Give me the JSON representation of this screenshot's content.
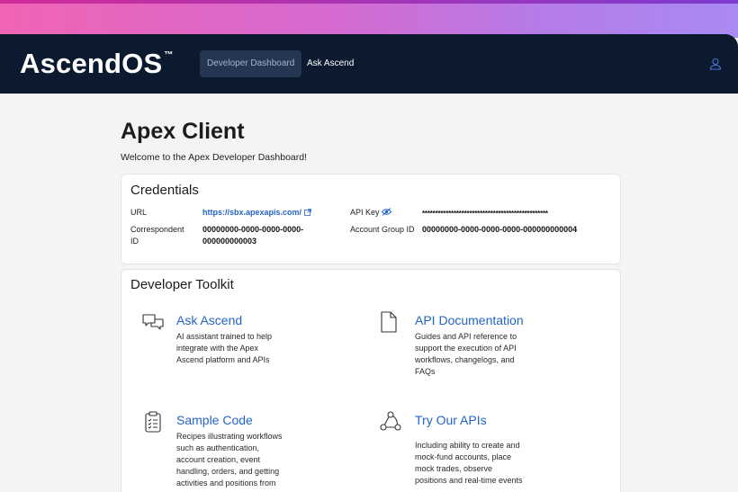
{
  "header": {
    "logo_text": "AscendOS",
    "logo_tm": "™",
    "nav": [
      {
        "label": "Developer Dashboard",
        "active": true
      },
      {
        "label": "Ask Ascend",
        "active": false
      }
    ],
    "user_icon": "user-icon"
  },
  "page": {
    "title": "Apex Client",
    "welcome": "Welcome to the Apex Developer Dashboard!"
  },
  "credentials": {
    "title": "Credentials",
    "url_label": "URL",
    "url_value": "https://sbx.apexapis.com/",
    "api_key_label": "API Key",
    "api_key_value": "************************************************",
    "correspondent_label_1": "Correspondent",
    "correspondent_label_2": "ID",
    "correspondent_value_1": "00000000-0000-0000-0000-",
    "correspondent_value_2": "000000000003",
    "account_group_label": "Account Group ID",
    "account_group_value": "00000000-0000-0000-0000-000000000004"
  },
  "toolkit": {
    "title": "Developer Toolkit",
    "items": [
      {
        "title": "Ask Ascend",
        "icon": "chat-icon",
        "desc": [
          "AI assistant trained to help",
          "integrate with the Apex",
          "Ascend platform and APIs"
        ]
      },
      {
        "title": "API Documentation",
        "icon": "document-icon",
        "desc": [
          "Guides and API reference to",
          "support the execution of API",
          "workflows, changelogs, and",
          "FAQs"
        ]
      },
      {
        "title": "Sample Code",
        "icon": "clipboard-icon",
        "desc": [
          "Recipes illustrating workflows",
          "such as authentication,",
          "account creation, event",
          "handling, orders, and getting",
          "activities and positions from"
        ]
      },
      {
        "title": "Try Our APIs",
        "icon": "webhook-icon",
        "desc": [
          "Including ability to create and",
          "mock-fund accounts, place",
          "mock trades, observe",
          "positions and real-time events"
        ]
      }
    ]
  },
  "colors": {
    "header_bg": "#0b1a2e",
    "accent_link": "#2364c8",
    "gradient_start": "#f064b4",
    "gradient_end": "#a98af2"
  }
}
